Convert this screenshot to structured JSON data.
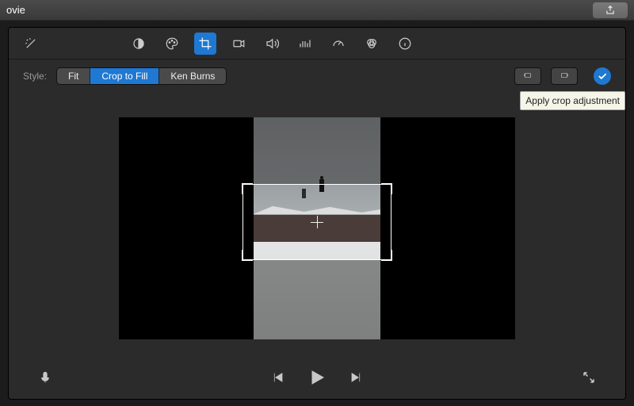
{
  "titlebar": {
    "title": "ovie"
  },
  "tools": {
    "magic": "magic-wand-icon",
    "contrast": "contrast-icon",
    "palette": "palette-icon",
    "crop": "crop-icon",
    "camera": "camera-icon",
    "volume": "volume-icon",
    "equalizer": "equalizer-icon",
    "speed": "speedometer-icon",
    "color": "color-balance-icon",
    "info": "info-icon",
    "active": "crop"
  },
  "style": {
    "label": "Style:",
    "options": [
      "Fit",
      "Crop to Fill",
      "Ken Burns"
    ],
    "selected": "Crop to Fill"
  },
  "actions": {
    "rotate_ccw": "rotate-ccw-icon",
    "rotate_cw": "rotate-cw-icon",
    "apply": "checkmark-icon",
    "tooltip": "Apply crop adjustment"
  },
  "playback": {
    "mic": "microphone-icon",
    "prev": "previous-frame-icon",
    "play": "play-icon",
    "next": "next-frame-icon",
    "fullscreen": "fullscreen-icon"
  }
}
